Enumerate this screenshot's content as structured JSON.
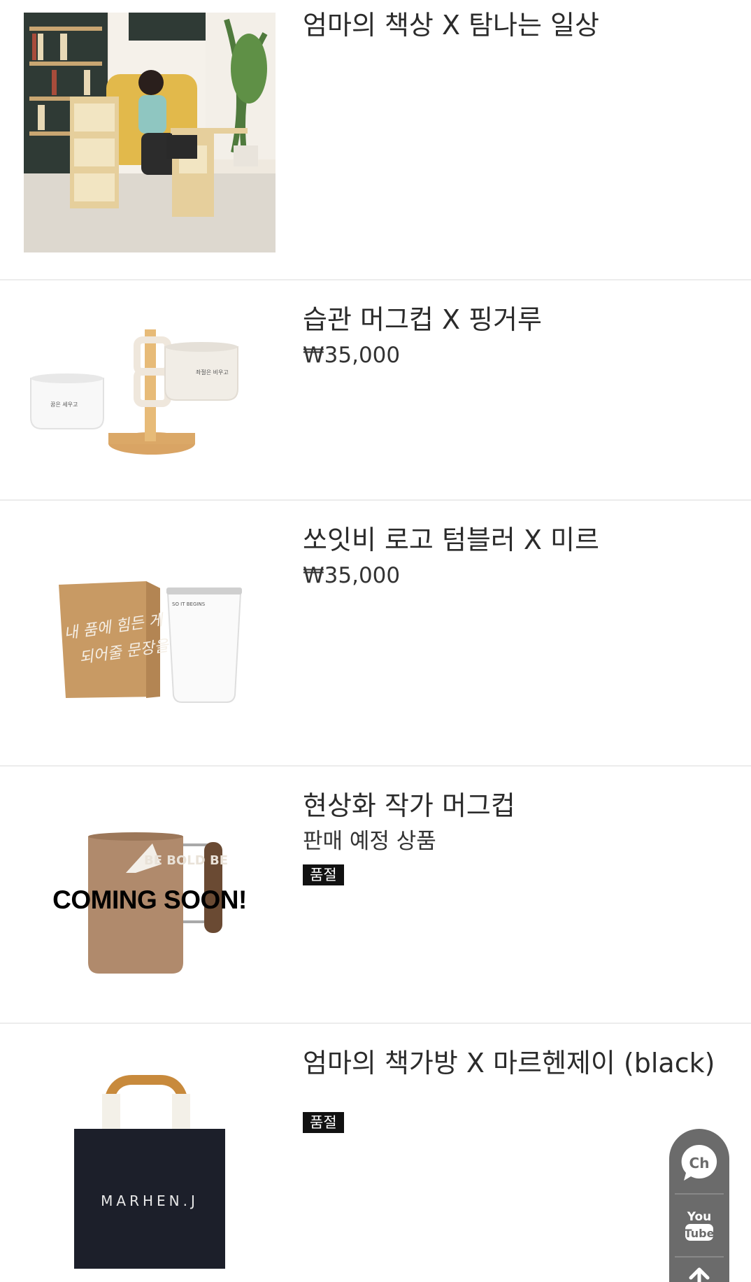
{
  "products": [
    {
      "title": "엄마의 책상 X 탐나는 일상",
      "price": "",
      "subtitle": "",
      "badge": ""
    },
    {
      "title": "습관 머그컵 X 핑거루",
      "price": "₩35,000",
      "subtitle": "",
      "badge": ""
    },
    {
      "title": "쏘잇비 로고 텀블러 X 미르",
      "price": "₩35,000",
      "subtitle": "",
      "badge": ""
    },
    {
      "title": "현상화 작가 머그컵",
      "price": "",
      "subtitle": "판매 예정 상품",
      "badge": "품절",
      "overlay": "COMING SOON!"
    },
    {
      "title": "엄마의 책가방 X 마르헨제이 (black)",
      "price": "",
      "subtitle": "",
      "badge": "품절"
    }
  ],
  "image_text": {
    "mug_left": "꿈은 세우고",
    "mug_right": "좌절은 비우고",
    "tumbler_brand": "SO IT BEGINS",
    "box_handwriting_1": "내 품에 힘든 게",
    "box_handwriting_2": "되어줄 문장을",
    "mug_logo": "BE BOLD BE",
    "bag_brand": "MARHEN.J"
  },
  "quick_menu": {
    "chat_label": "Ch",
    "youtube_label_1": "You",
    "youtube_label_2": "Tube"
  },
  "colors": {
    "badge": "#111111",
    "quick_menu_bg": "#6b6b6b",
    "divider": "#ececec"
  }
}
